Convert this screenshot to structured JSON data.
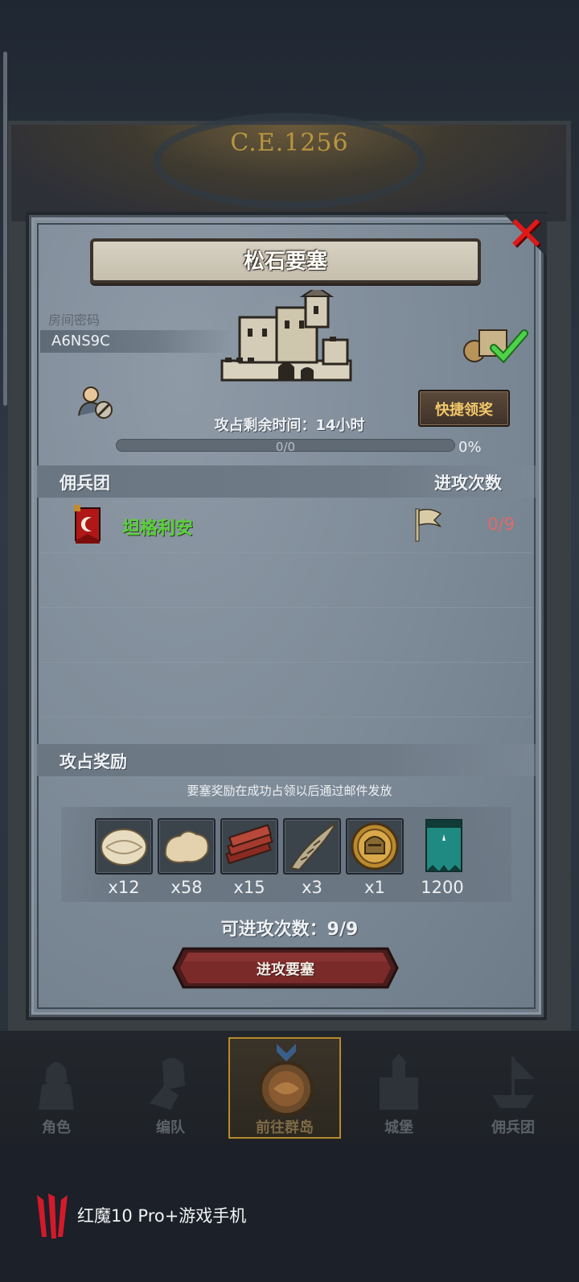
{
  "background": {
    "era_label": "C.E.1256"
  },
  "dialog": {
    "title": "松石要塞",
    "close_icon": "close-x-icon",
    "room_password_label": "房间密码",
    "room_code": "A6NS9C",
    "quick_claim_label": "快捷领奖",
    "time_remaining_text": "攻占剩余时间：14小时",
    "progress": {
      "text": "0/0",
      "percent_text": "0%",
      "fraction": 0
    },
    "mercenary_header": "佣兵团",
    "attack_count_header": "进攻次数",
    "mercenaries": [
      {
        "name": "坦格利安",
        "attacks": "0/9",
        "banner_icon": "red-crescent-banner-icon",
        "flag_icon": "flag-icon"
      }
    ],
    "rewards_header": "攻占奖励",
    "rewards_note": "要塞奖励在成功占领以后通过邮件发放",
    "rewards": [
      {
        "icon": "fur-pelt-icon",
        "qty": "x12"
      },
      {
        "icon": "fleece-icon",
        "qty": "x58"
      },
      {
        "icon": "wood-planks-icon",
        "qty": "x15"
      },
      {
        "icon": "horn-icon",
        "qty": "x3"
      },
      {
        "icon": "knight-helmet-medal-icon",
        "qty": "x1"
      },
      {
        "icon": "guild-banner-icon",
        "qty": "1200"
      }
    ],
    "attacks_available": "可进攻次数：9/9",
    "attack_button_label": "进攻要塞"
  },
  "bottom_nav": [
    {
      "label": "角色",
      "icon": "knight-icon",
      "active": false
    },
    {
      "label": "编队",
      "icon": "formation-icon",
      "active": false
    },
    {
      "label": "前往群岛",
      "icon": "islands-icon",
      "active": true
    },
    {
      "label": "城堡",
      "icon": "castle-icon",
      "active": false
    },
    {
      "label": "佣兵团",
      "icon": "ship-icon",
      "active": false
    }
  ],
  "device_footer": {
    "brand_text": "红魔10 Pro+游戏手机"
  },
  "colors": {
    "merc_name": "#5bd03b",
    "attack_count": "#e06a6a",
    "close": "#e01818",
    "quick_claim_text": "#f2c86a",
    "nav_active_border": "#b78a2c"
  }
}
